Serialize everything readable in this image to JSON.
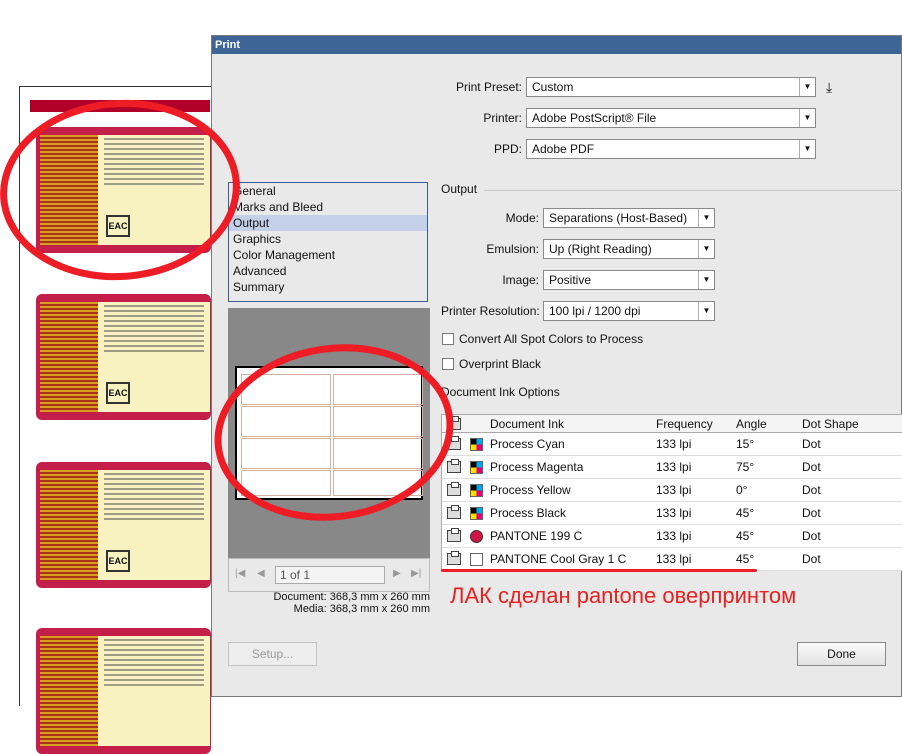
{
  "window_title": "Print",
  "preset": {
    "label": "Print Preset:",
    "value": "Custom"
  },
  "printer": {
    "label": "Printer:",
    "value": "Adobe PostScript® File"
  },
  "ppd": {
    "label": "PPD:",
    "value": "Adobe PDF"
  },
  "nav_items": [
    "General",
    "Marks and Bleed",
    "Output",
    "Graphics",
    "Color Management",
    "Advanced",
    "Summary"
  ],
  "nav_selected": "Output",
  "output": {
    "title": "Output",
    "mode": {
      "label": "Mode:",
      "value": "Separations (Host-Based)"
    },
    "emulsion": {
      "label": "Emulsion:",
      "value": "Up (Right Reading)"
    },
    "image": {
      "label": "Image:",
      "value": "Positive"
    },
    "resolution": {
      "label": "Printer Resolution:",
      "value": "100 lpi / 1200 dpi"
    },
    "convert_spot": {
      "label": "Convert All Spot Colors to Process",
      "checked": false
    },
    "overprint_black": {
      "label": "Overprint Black",
      "checked": false
    }
  },
  "ink_options": {
    "title": "Document Ink Options",
    "headers": [
      "Document Ink",
      "Frequency",
      "Angle",
      "Dot Shape"
    ],
    "rows": [
      {
        "name": "Process Cyan",
        "frequency": "133 lpi",
        "angle": "15°",
        "dot": "Dot",
        "swatch": "process"
      },
      {
        "name": "Process Magenta",
        "frequency": "133 lpi",
        "angle": "75°",
        "dot": "Dot",
        "swatch": "process"
      },
      {
        "name": "Process Yellow",
        "frequency": "133 lpi",
        "angle": "0°",
        "dot": "Dot",
        "swatch": "process"
      },
      {
        "name": "Process Black",
        "frequency": "133 lpi",
        "angle": "45°",
        "dot": "Dot",
        "swatch": "process"
      },
      {
        "name": "PANTONE 199 C",
        "frequency": "133 lpi",
        "angle": "45°",
        "dot": "Dot",
        "swatch": "#d21444"
      },
      {
        "name": "PANTONE Cool Gray 1 C",
        "frequency": "133 lpi",
        "angle": "45°",
        "dot": "Dot",
        "swatch": "#ffffff"
      }
    ]
  },
  "pager": {
    "page": "1 of 1"
  },
  "doc_info": {
    "document": "Document: 368,3 mm x 260 mm",
    "media": "Media: 368,3 mm x 260 mm"
  },
  "buttons": {
    "setup": "Setup...",
    "done": "Done"
  },
  "annotation": "ЛАК сделан pantone оверпринтом",
  "colors": {
    "titlebar": "#3d6595",
    "annotation_red": "#ee1c25",
    "label_red": "#c41e4a"
  }
}
